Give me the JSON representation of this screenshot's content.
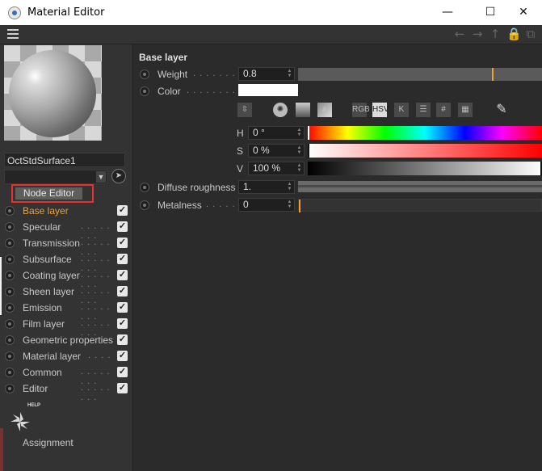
{
  "window": {
    "title": "Material Editor",
    "controls": [
      "—",
      "☐",
      "✕"
    ]
  },
  "toolbar": {
    "nav_icons": [
      "←",
      "→",
      "↑",
      "🔒",
      "⧉"
    ]
  },
  "left": {
    "material_name": "OctStdSurface1",
    "node_editor_label": "Node Editor",
    "layers": [
      {
        "label": "Base layer",
        "active": true,
        "checked": true
      },
      {
        "label": "Specular",
        "checked": true
      },
      {
        "label": "Transmission",
        "checked": true
      },
      {
        "label": "Subsurface",
        "checked": true
      },
      {
        "label": "Coating layer",
        "checked": true
      },
      {
        "label": "Sheen layer",
        "checked": true
      },
      {
        "label": "Emission",
        "checked": true
      },
      {
        "label": "Film layer",
        "checked": true
      },
      {
        "label": "Geometric properties",
        "checked": true
      },
      {
        "label": "Material layer",
        "checked": true
      },
      {
        "label": "Common",
        "checked": true
      },
      {
        "label": "Editor",
        "checked": true
      }
    ],
    "help_label": "HELP",
    "assignment_label": "Assignment"
  },
  "main": {
    "section_title": "Base layer",
    "weight": {
      "label": "Weight",
      "value": "0.8",
      "slider_fraction": 0.8
    },
    "color": {
      "label": "Color",
      "swatch": "#ffffff"
    },
    "color_tools": [
      "RGB",
      "HSV",
      "K",
      "#"
    ],
    "hsv": [
      {
        "label": "H",
        "value": "0 °"
      },
      {
        "label": "S",
        "value": "0 %"
      },
      {
        "label": "V",
        "value": "100 %"
      }
    ],
    "diffuse_roughness": {
      "label": "Diffuse roughness",
      "value": "1."
    },
    "metalness": {
      "label": "Metalness",
      "value": "0",
      "slider_fraction": 0.0
    }
  },
  "colors": {
    "accent": "#f0a030",
    "highlight_box": "#e8312e"
  }
}
